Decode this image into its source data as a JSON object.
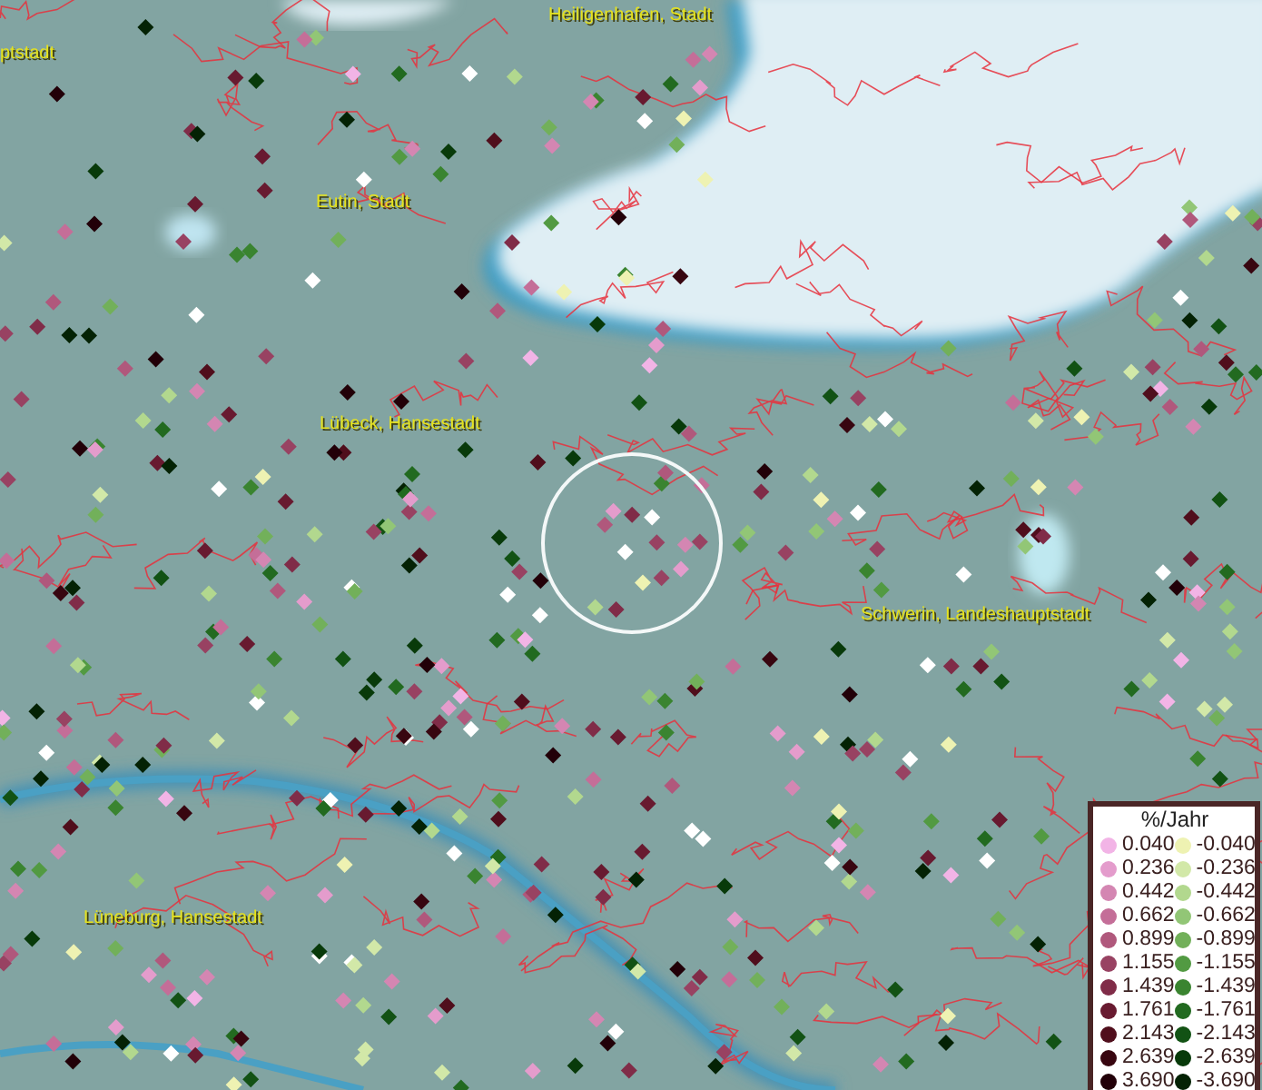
{
  "map": {
    "labels": [
      {
        "text": "Heiligenhafen, Stadt"
      },
      {
        "text": "ptstadt"
      },
      {
        "text": "Eutin, Stadt"
      },
      {
        "text": "Lübeck, Hansestadt"
      },
      {
        "text": "Schwerin, Landeshauptstadt"
      },
      {
        "text": "Lüneburg, Hansestadt"
      }
    ]
  },
  "legend": {
    "title": "%/Jahr",
    "positive_items": [
      {
        "value": "0.040",
        "color": "#f2b4e6"
      },
      {
        "value": "0.236",
        "color": "#e49ccc"
      },
      {
        "value": "0.442",
        "color": "#d486b2"
      },
      {
        "value": "0.662",
        "color": "#c46e98"
      },
      {
        "value": "0.899",
        "color": "#b0587c"
      },
      {
        "value": "1.155",
        "color": "#984262"
      },
      {
        "value": "1.439",
        "color": "#802c48"
      },
      {
        "value": "1.761",
        "color": "#681a30"
      },
      {
        "value": "2.143",
        "color": "#500e1c"
      },
      {
        "value": "2.639",
        "color": "#380610"
      },
      {
        "value": "3.690",
        "color": "#220008"
      }
    ],
    "negative_items": [
      {
        "value": "-0.040",
        "color": "#eef2b2"
      },
      {
        "value": "-0.236",
        "color": "#d2e8a8"
      },
      {
        "value": "-0.442",
        "color": "#b2d88e"
      },
      {
        "value": "-0.662",
        "color": "#92c676"
      },
      {
        "value": "-0.899",
        "color": "#72b05a"
      },
      {
        "value": "-1.155",
        "color": "#529a42"
      },
      {
        "value": "-1.439",
        "color": "#3a8430"
      },
      {
        "value": "-1.761",
        "color": "#226a20"
      },
      {
        "value": "-2.143",
        "color": "#125214"
      },
      {
        "value": "-2.639",
        "color": "#083a0a"
      },
      {
        "value": "-3.690",
        "color": "#042204"
      }
    ]
  }
}
